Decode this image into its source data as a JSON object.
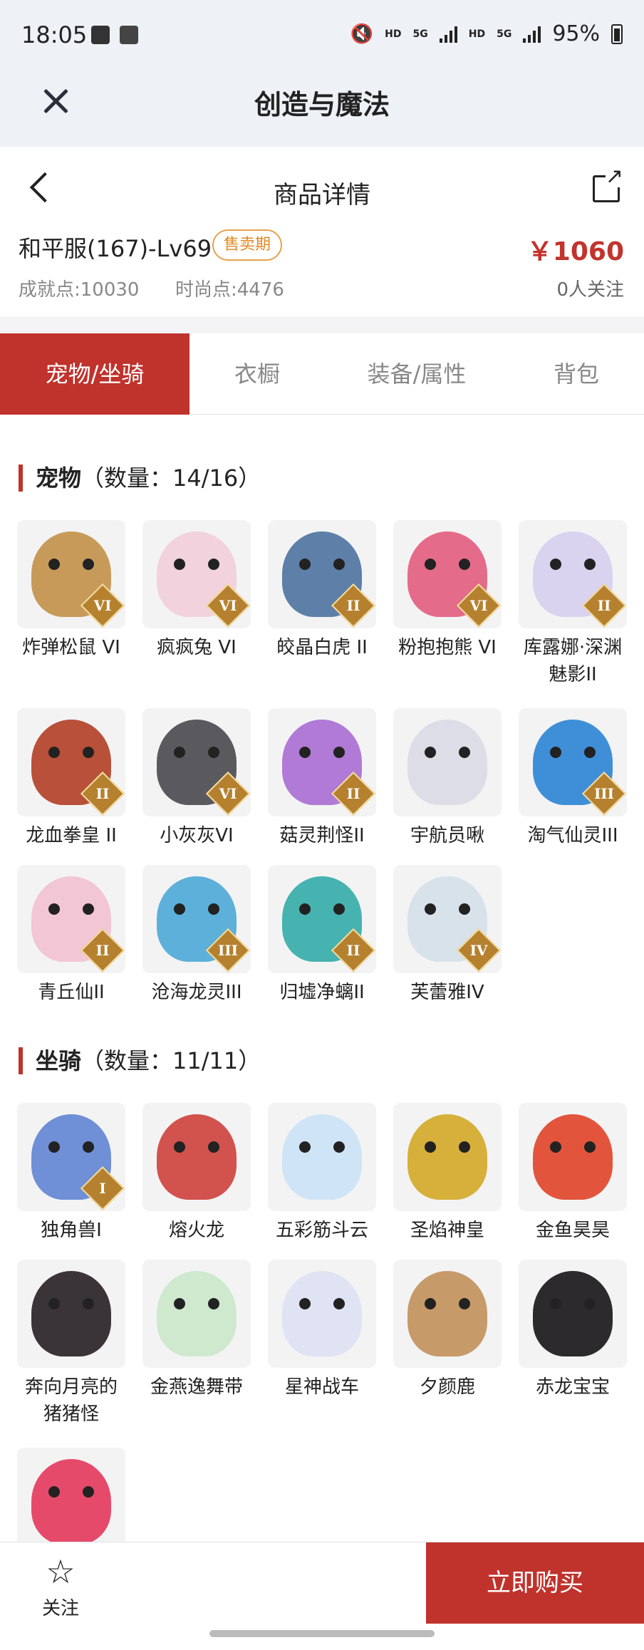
{
  "status_bar": {
    "time": "18:05",
    "battery": "95%",
    "net1": "HD",
    "net2": "5G",
    "net3": "HD",
    "net4": "5G"
  },
  "app": {
    "title": "创造与魔法"
  },
  "header": {
    "title": "商品详情"
  },
  "item": {
    "name": "和平服(167)-Lv69",
    "badge": "售卖期",
    "price": "￥1060",
    "achievement": "成就点:10030",
    "fashion": "时尚点:4476",
    "followers": "0人关注"
  },
  "tabs": [
    "宠物/坐骑",
    "衣橱",
    "装备/属性",
    "背包"
  ],
  "pets": {
    "title": "宠物",
    "count": "（数量：14/16）",
    "items": [
      {
        "label": "炸弹松鼠 VI",
        "rank": "VI",
        "color": "#c89a5a"
      },
      {
        "label": "疯疯兔 VI",
        "rank": "VI",
        "color": "#f2d2dc"
      },
      {
        "label": "皎晶白虎 II",
        "rank": "II",
        "color": "#5d7fa8"
      },
      {
        "label": "粉抱抱熊 VI",
        "rank": "VI",
        "color": "#e56b8a"
      },
      {
        "label": "库露娜·深渊魅影II",
        "rank": "II",
        "color": "#d9d3f0"
      },
      {
        "label": "龙血拳皇 II",
        "rank": "II",
        "color": "#b8503a"
      },
      {
        "label": "小灰灰VI",
        "rank": "VI",
        "color": "#5a5a5e"
      },
      {
        "label": "菇灵荆怪II",
        "rank": "II",
        "color": "#b07ad6"
      },
      {
        "label": "宇航员啾",
        "rank": "",
        "color": "#dcdde6"
      },
      {
        "label": "淘气仙灵III",
        "rank": "III",
        "color": "#3f8fd8"
      },
      {
        "label": "青丘仙II",
        "rank": "II",
        "color": "#f2c6d4"
      },
      {
        "label": "沧海龙灵III",
        "rank": "III",
        "color": "#5cb0d9"
      },
      {
        "label": "归墟净螭II",
        "rank": "II",
        "color": "#46b3b0"
      },
      {
        "label": "芙蕾雅IV",
        "rank": "IV",
        "color": "#d8e2ea"
      }
    ]
  },
  "mounts": {
    "title": "坐骑",
    "count": "（数量：11/11）",
    "items": [
      {
        "label": "独角兽I",
        "rank": "I",
        "color": "#6f8fd6"
      },
      {
        "label": "熔火龙",
        "rank": "",
        "color": "#d2524e"
      },
      {
        "label": "五彩筋斗云",
        "rank": "",
        "color": "#cfe4f6"
      },
      {
        "label": "圣焰神皇",
        "rank": "",
        "color": "#d6b03a"
      },
      {
        "label": "金鱼昊昊",
        "rank": "",
        "color": "#e2553c"
      },
      {
        "label": "奔向月亮的猪猪怪",
        "rank": "",
        "color": "#3a3438"
      },
      {
        "label": "金燕逸舞带",
        "rank": "",
        "color": "#cfe9cf"
      },
      {
        "label": "星神战车",
        "rank": "",
        "color": "#dfe3f3"
      },
      {
        "label": "夕颜鹿",
        "rank": "",
        "color": "#c79a6a"
      },
      {
        "label": "赤龙宝宝",
        "rank": "",
        "color": "#2c2a2c"
      },
      {
        "label": "",
        "rank": "",
        "color": "#e64a6a"
      }
    ]
  },
  "bottom": {
    "follow": "关注",
    "buy": "立即购买"
  },
  "colors": {
    "accent": "#c0322c",
    "badge": "#e08a25"
  }
}
